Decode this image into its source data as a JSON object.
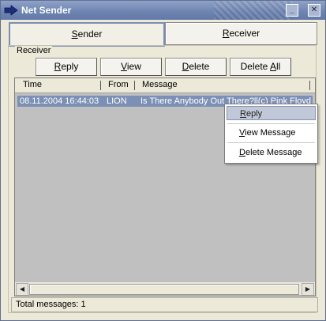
{
  "window": {
    "title": "Net Sender"
  },
  "titlebar": {
    "minimize_glyph": "_",
    "close_glyph": "✕"
  },
  "tabs": [
    {
      "label_accel": "S",
      "label_rest": "ender"
    },
    {
      "label_accel": "R",
      "label_rest": "eceiver"
    }
  ],
  "group": {
    "label": "Receiver"
  },
  "actions": {
    "reply": {
      "accel": "R",
      "rest": "eply"
    },
    "view": {
      "accel": "V",
      "rest": "iew"
    },
    "delete": {
      "accel": "D",
      "rest": "elete"
    },
    "delete_all": {
      "pre": "Delete ",
      "accel": "A",
      "rest": "ll"
    }
  },
  "list": {
    "columns": [
      "Time",
      "From",
      "Message"
    ],
    "rows": [
      {
        "time": "08.11.2004 16:44:03",
        "from": "LION",
        "message": "Is There Anybody Out There?ll(c) Pink Floyd"
      }
    ]
  },
  "context_menu": {
    "reply": {
      "accel": "R",
      "rest": "eply"
    },
    "view": {
      "accel": "V",
      "rest": "iew Message"
    },
    "delete": {
      "accel": "D",
      "rest": "elete Message"
    }
  },
  "status": {
    "text": "Total messages: 1"
  },
  "scrollbar": {
    "left_arrow": "◀",
    "right_arrow": "▶"
  },
  "colors": {
    "titlebar": "#6d83b0",
    "selection": "#7c8fb4",
    "menu_highlight": "#c1c8d7"
  }
}
